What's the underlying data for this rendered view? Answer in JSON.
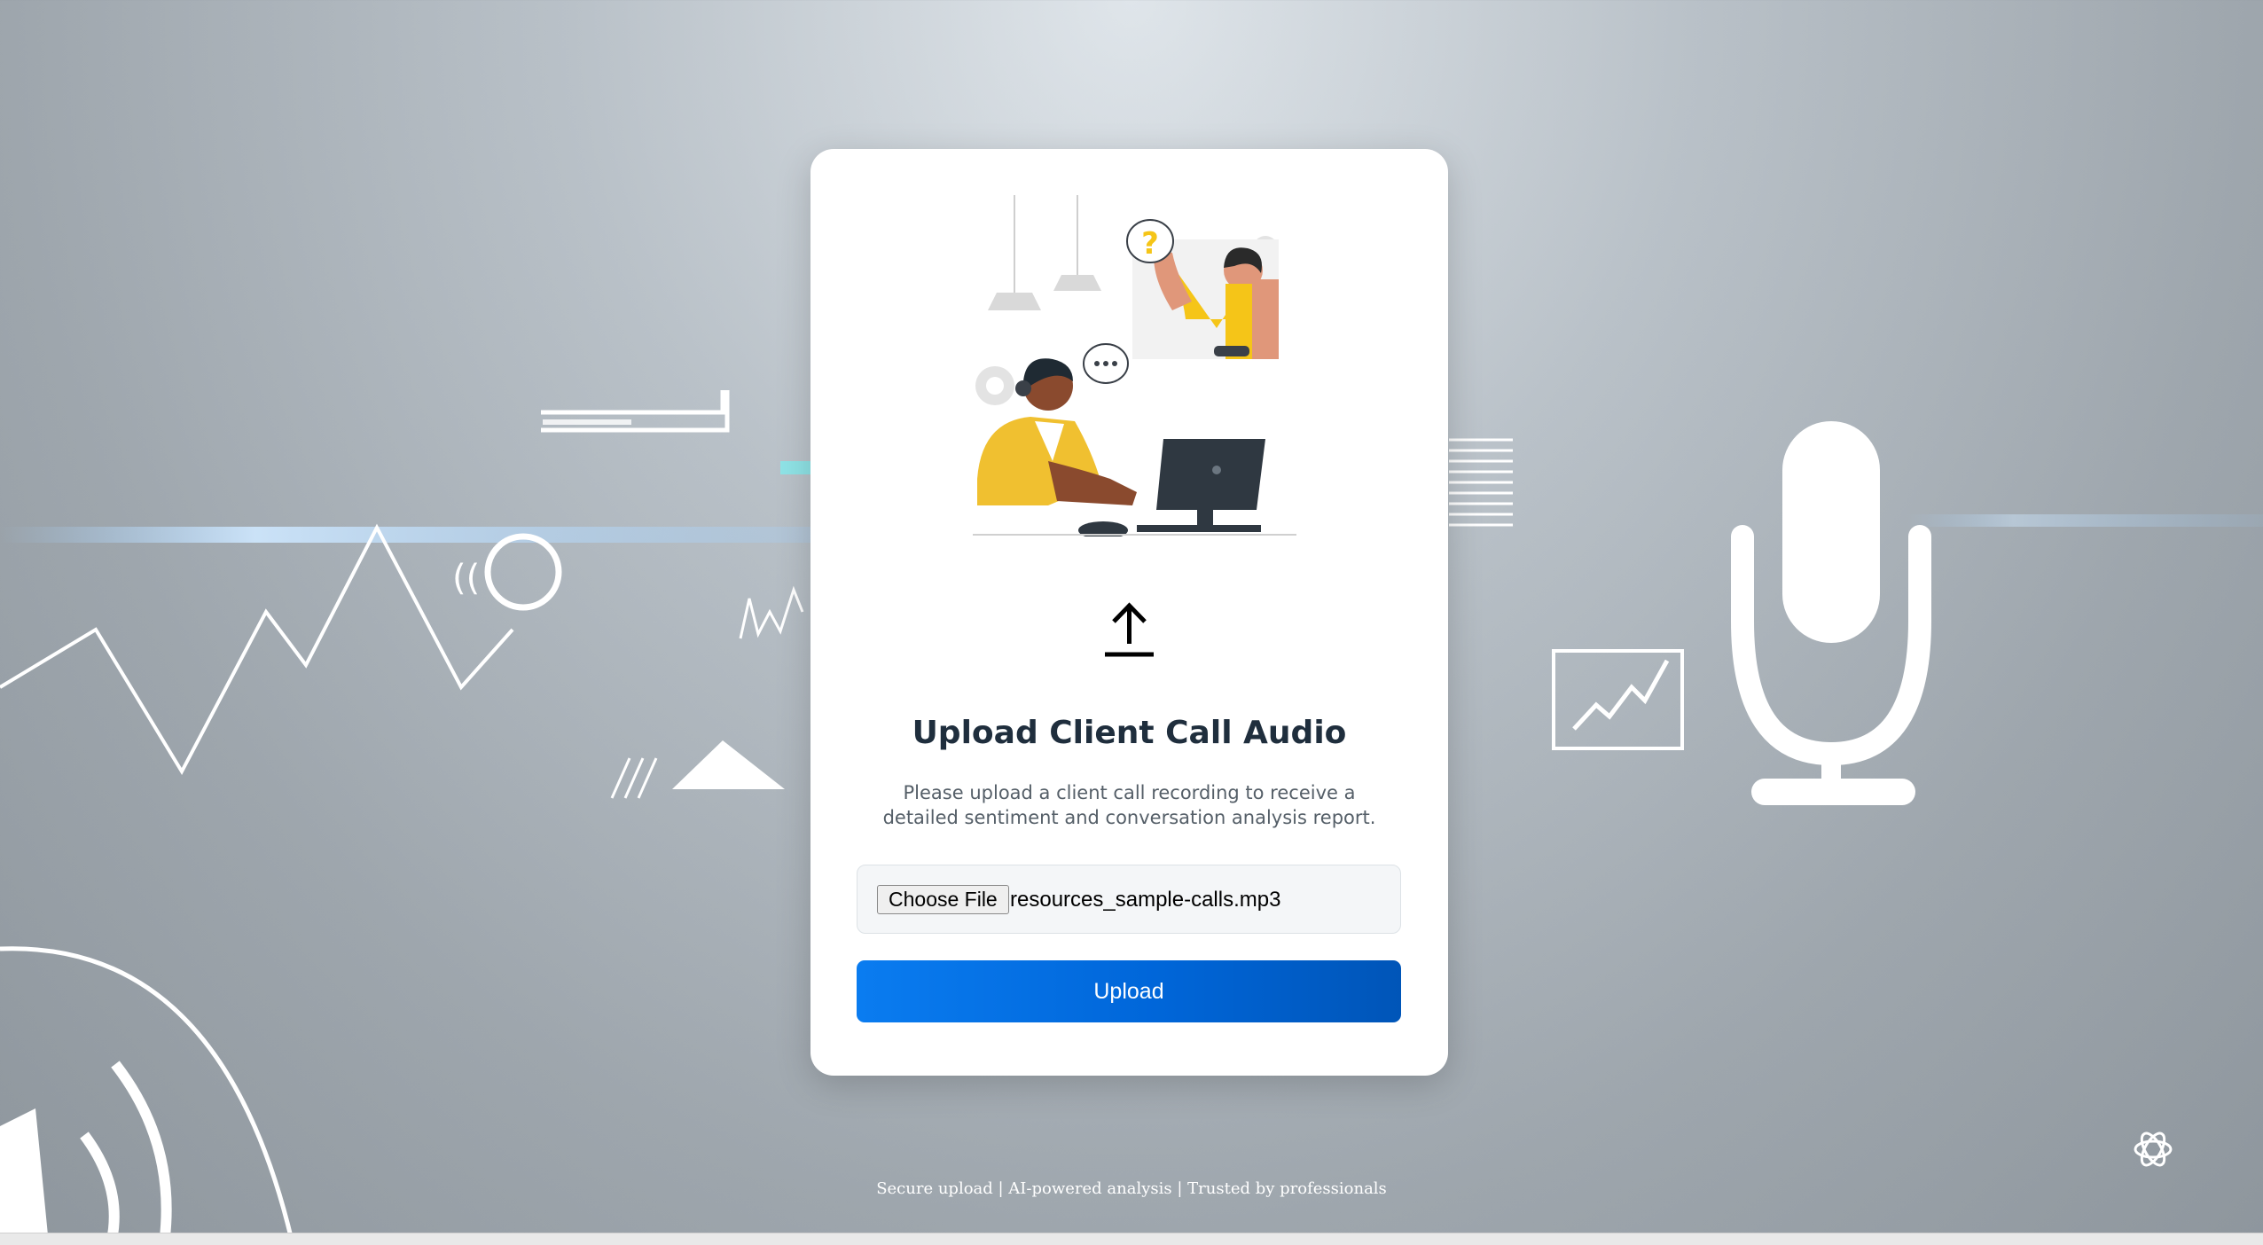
{
  "card": {
    "title": "Upload Client Call Audio",
    "description": "Please upload a client call recording to receive a detailed sentiment and conversation analysis report.",
    "file_input": {
      "button_label": "Choose File",
      "file_name": "resources_sample-calls.mp3"
    },
    "upload_label": "Upload",
    "illustration_bubble_text": "?"
  },
  "footer": {
    "text": "Secure upload | AI-powered analysis | Trusted by professionals"
  },
  "colors": {
    "primary": "#0a7cf0",
    "accent_yellow": "#f5c518",
    "title": "#1f2e3d"
  }
}
